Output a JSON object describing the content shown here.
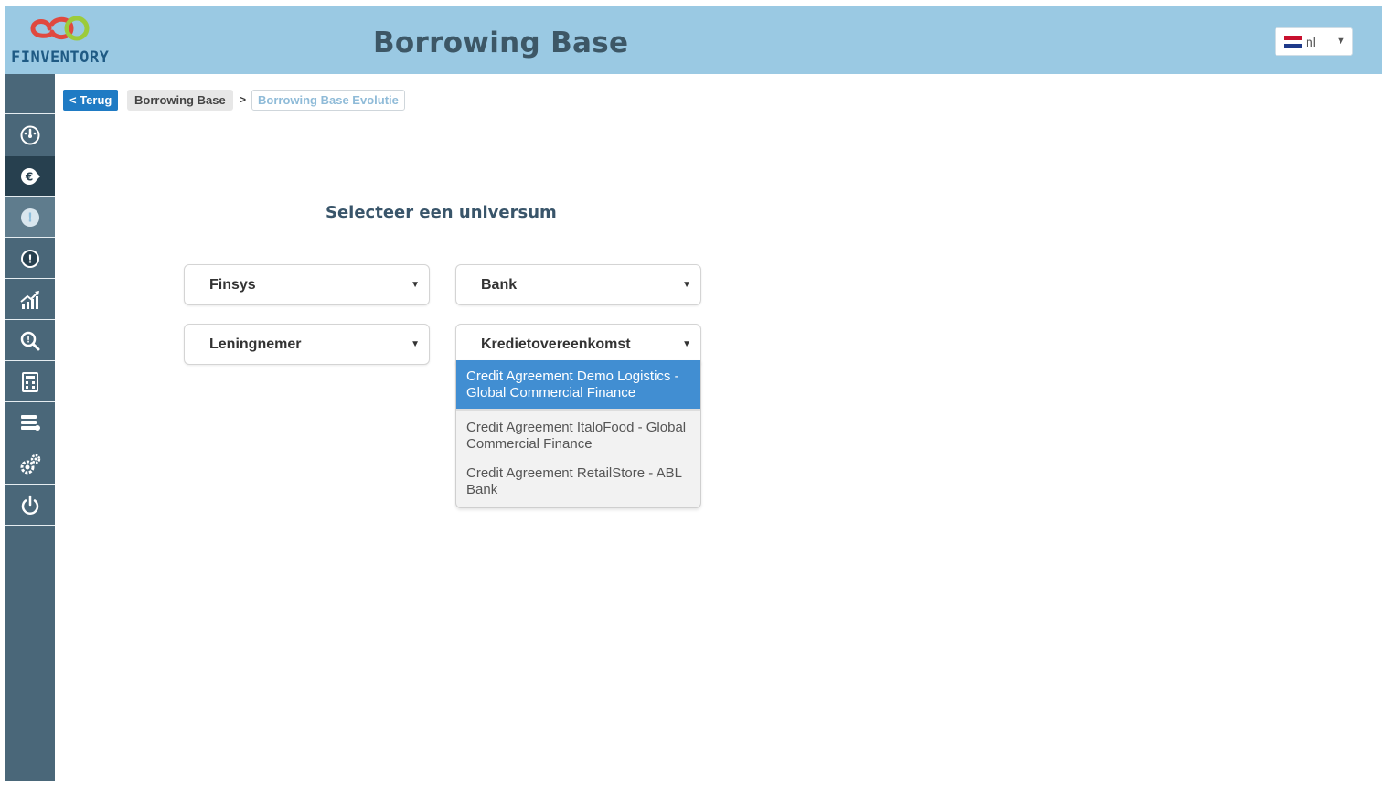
{
  "header": {
    "logo_text": "FINVENTORY",
    "title": "Borrowing Base",
    "language": {
      "label": "nl",
      "flag": "nl-flag-icon"
    }
  },
  "sidebar": {
    "items": [
      {
        "name": "dashboard-gauge-icon",
        "state": "normal"
      },
      {
        "name": "euro-icon",
        "state": "active"
      },
      {
        "name": "info-alert-icon",
        "state": "light"
      },
      {
        "name": "warning-alert-icon",
        "state": "normal"
      },
      {
        "name": "growth-chart-icon",
        "state": "normal"
      },
      {
        "name": "search-zoom-icon",
        "state": "normal"
      },
      {
        "name": "report-calculator-icon",
        "state": "normal"
      },
      {
        "name": "database-stack-icon",
        "state": "normal"
      },
      {
        "name": "settings-gears-icon",
        "state": "normal"
      },
      {
        "name": "power-icon",
        "state": "normal"
      }
    ]
  },
  "breadcrumb": {
    "back_label": "< Terug",
    "items": [
      "Borrowing Base",
      "Borrowing Base Evolutie"
    ],
    "separator": ">"
  },
  "main": {
    "section_title": "Selecteer een universum",
    "selects": {
      "finsys": "Finsys",
      "bank": "Bank",
      "borrower": "Leningnemer",
      "credit_agreement": "Kredietovereenkomst"
    },
    "dropdown_options": [
      "Credit Agreement Demo Logistics - Global Commercial Finance",
      "Credit Agreement ItaloFood - Global Commercial Finance",
      "Credit Agreement RetailStore - ABL Bank"
    ],
    "selected_option_index": 0
  },
  "colors": {
    "header_bg": "#9ac9e3",
    "sidebar_bg": "#4a6779",
    "sidebar_active": "#27404f",
    "back_button": "#1f7bc4",
    "selected_option": "#418ed2"
  }
}
